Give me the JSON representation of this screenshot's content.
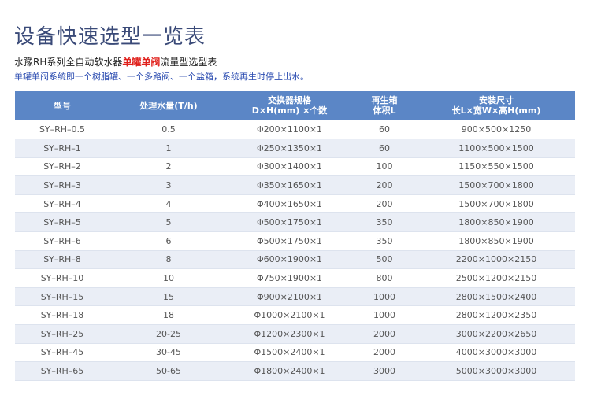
{
  "title": "设备快速选型一览表",
  "subtitle": {
    "prefix": "水豫RH系列全自动软水器",
    "highlight": "单罐单阀",
    "suffix": "流量型选型表"
  },
  "description": "单罐单阀系统即一个树脂罐、一个多路阀、一个盐箱，系统再生时停止出水。",
  "table": {
    "headers": [
      {
        "line1": "型号",
        "line2": ""
      },
      {
        "line1": "处理水量(T/h)",
        "line2": ""
      },
      {
        "line1": "交换器规格",
        "line2": "D×H(mm) ×个数"
      },
      {
        "line1": "再生箱",
        "line2": "体积L"
      },
      {
        "line1": "安装尺寸",
        "line2": "长L×宽W×高H(mm)"
      }
    ],
    "rows": [
      [
        "SY–RH–0.5",
        "0.5",
        "Φ200×1100×1",
        "60",
        "900×500×1250"
      ],
      [
        "SY–RH–1",
        "1",
        "Φ250×1350×1",
        "60",
        "1100×500×1500"
      ],
      [
        "SY–RH–2",
        "2",
        "Φ300×1400×1",
        "100",
        "1150×550×1500"
      ],
      [
        "SY–RH–3",
        "3",
        "Φ350×1650×1",
        "200",
        "1500×700×1800"
      ],
      [
        "SY–RH–4",
        "4",
        "Φ400×1650×1",
        "200",
        "1500×700×1800"
      ],
      [
        "SY–RH–5",
        "5",
        "Φ500×1750×1",
        "350",
        "1800×850×1900"
      ],
      [
        "SY–RH–6",
        "6",
        "Φ500×1750×1",
        "350",
        "1800×850×1900"
      ],
      [
        "SY–RH–8",
        "8",
        "Φ600×1900×1",
        "500",
        "2200×1000×2150"
      ],
      [
        "SY–RH–10",
        "10",
        "Φ750×1900×1",
        "800",
        "2500×1200×2150"
      ],
      [
        "SY–RH–15",
        "15",
        "Φ900×2100×1",
        "1000",
        "2800×1500×2400"
      ],
      [
        "SY–RH–18",
        "18",
        "Φ1000×2100×1",
        "1000",
        "2800×1200×2350"
      ],
      [
        "SY–RH–25",
        "20-25",
        "Φ1200×2300×1",
        "2000",
        "3000×2200×2650"
      ],
      [
        "SY–RH–45",
        "30-45",
        "Φ1500×2400×1",
        "2000",
        "4000×3000×3000"
      ],
      [
        "SY–RH–65",
        "50-65",
        "Φ1800×2400×1",
        "3000",
        "5000×3000×3000"
      ]
    ]
  },
  "colors": {
    "title": "#3a4a78",
    "highlight": "#e0201b",
    "description": "#2a4bb0",
    "header_bg": "#5b86c6",
    "row_alt_bg": "#eaeef6"
  }
}
